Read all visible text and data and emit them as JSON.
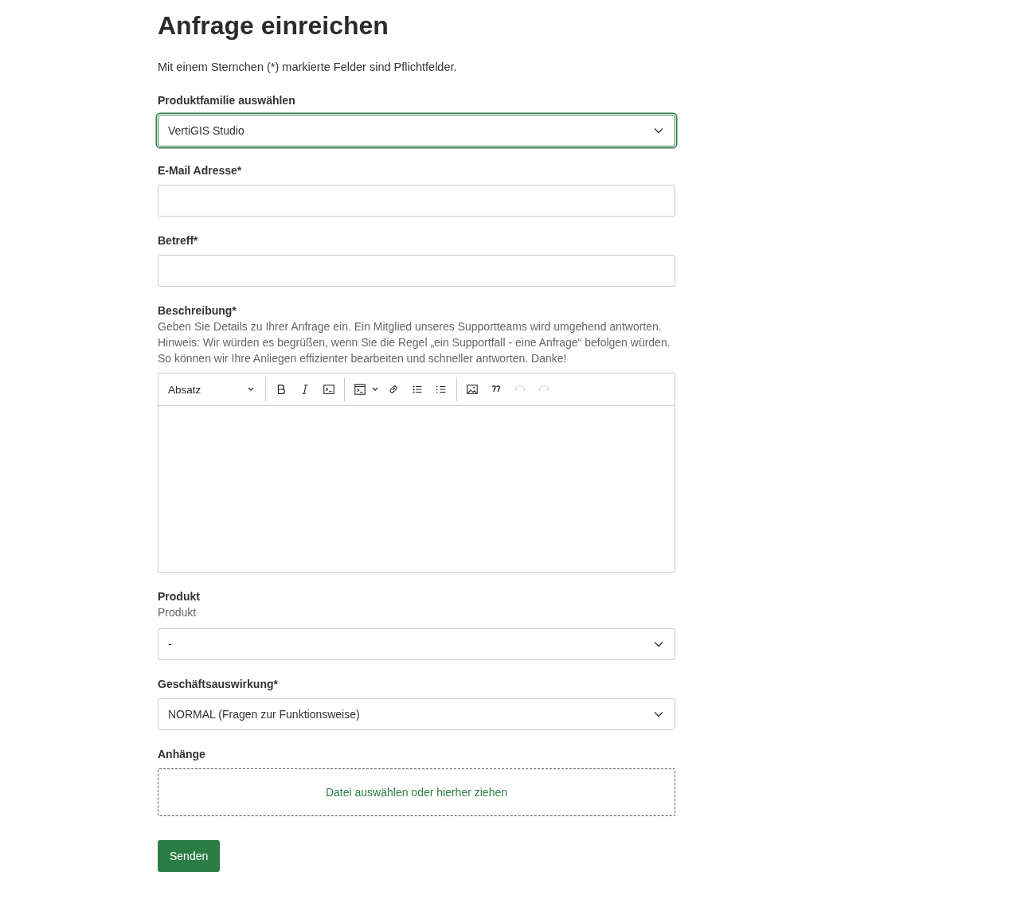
{
  "title": "Anfrage einreichen",
  "intro": "Mit einem Sternchen (*) markierte Felder sind Pflichtfelder.",
  "fields": [
    {
      "kind": "select",
      "label": "Produktfamilie auswählen",
      "value": "VertiGIS Studio",
      "focused": true
    },
    {
      "kind": "text",
      "label": "E-Mail Adresse*",
      "focused": false
    },
    {
      "kind": "text",
      "label": "Betreff*",
      "focused": false
    },
    {
      "kind": "editor",
      "label": "Beschreibung*",
      "help": "Geben Sie Details zu Ihrer Anfrage ein. Ein Mitglied unseres Supportteams wird umgehend antworten.\nHinweis: Wir würden es begrüßen, wenn Sie die Regel „ein Supportfall - eine Anfrage“ befolgen würden.\nSo können wir Ihre Anliegen effizienter bearbeiten und schneller antworten. Danke!",
      "toolbar": {
        "format": "Absatz",
        "groups": [
          [
            {
              "kind": "bold",
              "disabled": false
            },
            {
              "kind": "italic",
              "disabled": false
            },
            {
              "kind": "code",
              "disabled": false
            }
          ],
          [
            {
              "kind": "codeblock",
              "disabled": false
            },
            {
              "kind": "link",
              "disabled": false
            },
            {
              "kind": "bullets",
              "disabled": false
            },
            {
              "kind": "numbers",
              "disabled": false
            }
          ],
          [
            {
              "kind": "image",
              "disabled": false
            },
            {
              "kind": "quote",
              "disabled": false
            },
            {
              "kind": "undo",
              "disabled": true
            },
            {
              "kind": "redo",
              "disabled": true
            }
          ]
        ]
      }
    },
    {
      "kind": "select",
      "label": "Produkt",
      "help": "Produkt",
      "value": "-",
      "focused": false
    },
    {
      "kind": "select",
      "label": "Geschäftsauswirkung*",
      "value": "NORMAL (Fragen zur Funktionsweise)",
      "focused": false
    },
    {
      "kind": "dropzone",
      "label": "Anhänge",
      "prompt": "Datei auswählen oder hierher ziehen"
    }
  ],
  "submit": "Senden"
}
